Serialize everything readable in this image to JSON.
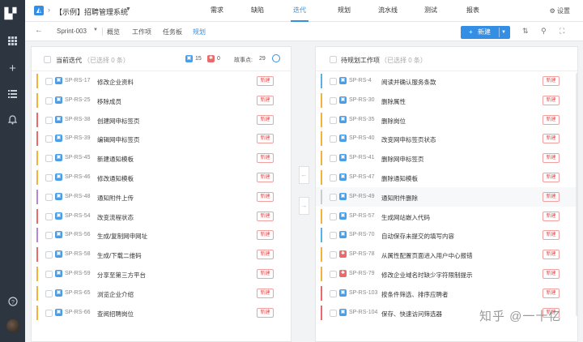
{
  "rail": {
    "logo": "▙▘",
    "icons": [
      "grid-icon",
      "plus-icon",
      "list-icon",
      "bell-icon",
      "help-icon",
      "avatar"
    ]
  },
  "topbar": {
    "project_name": "【示例】招聘管理系统",
    "tabs": [
      {
        "label": "需求",
        "active": false
      },
      {
        "label": "缺陷",
        "active": false
      },
      {
        "label": "迭代",
        "active": true
      },
      {
        "label": "规划",
        "active": false
      },
      {
        "label": "流水线",
        "active": false
      },
      {
        "label": "测试",
        "active": false
      },
      {
        "label": "报表",
        "active": false
      }
    ],
    "settings_label": "设置"
  },
  "subbar": {
    "sprint": "Sprint-003",
    "tabs": [
      {
        "label": "概览",
        "active": false
      },
      {
        "label": "工作项",
        "active": false
      },
      {
        "label": "任务板",
        "active": false
      },
      {
        "label": "规划",
        "active": true
      }
    ],
    "new_label": "新建"
  },
  "left_panel": {
    "title": "当前迭代",
    "selected": "（已选择 0 条）",
    "story_count": "15",
    "bug_count": "0",
    "points_label": "故事点:",
    "points": "29",
    "items": [
      {
        "code": "SP-RS-17",
        "title": "修改企业资料",
        "status": "新建",
        "type": "story",
        "stripe": "#f2b33d"
      },
      {
        "code": "SP-RS-25",
        "title": "移除成员",
        "status": "新建",
        "type": "story",
        "stripe": "#f2b33d"
      },
      {
        "code": "SP-RS-38",
        "title": "创建网申标签页",
        "status": "新建",
        "type": "story",
        "stripe": "#e86a6a"
      },
      {
        "code": "SP-RS-39",
        "title": "编辑网申标签页",
        "status": "新建",
        "type": "story",
        "stripe": "#e86a6a"
      },
      {
        "code": "SP-RS-45",
        "title": "新建通知模板",
        "status": "新建",
        "type": "story",
        "stripe": "#f2b33d"
      },
      {
        "code": "SP-RS-46",
        "title": "修改通知模板",
        "status": "新建",
        "type": "story",
        "stripe": "#f2b33d"
      },
      {
        "code": "SP-RS-48",
        "title": "通知附件上传",
        "status": "新建",
        "type": "story",
        "stripe": "#b488d4"
      },
      {
        "code": "SP-RS-54",
        "title": "改变流程状态",
        "status": "新建",
        "type": "story",
        "stripe": "#e86a6a"
      },
      {
        "code": "SP-RS-56",
        "title": "生成/复制网申网址",
        "status": "新建",
        "type": "story",
        "stripe": "#b488d4"
      },
      {
        "code": "SP-RS-58",
        "title": "生成/下载二维码",
        "status": "新建",
        "type": "story",
        "stripe": "#e86a6a"
      },
      {
        "code": "SP-RS-59",
        "title": "分享至第三方平台",
        "status": "新建",
        "type": "story",
        "stripe": "#f2b33d"
      },
      {
        "code": "SP-RS-65",
        "title": "浏览企业介绍",
        "status": "新建",
        "type": "story",
        "stripe": "#f2b33d"
      },
      {
        "code": "SP-RS-66",
        "title": "查阅招聘岗位",
        "status": "新建",
        "type": "story",
        "stripe": "#f2b33d"
      }
    ]
  },
  "right_panel": {
    "title": "待规划工作项",
    "selected": "（已选择 0 条）",
    "items": [
      {
        "code": "SP-RS-4",
        "title": "阅读并确认服务条款",
        "status": "新建",
        "type": "story",
        "stripe": "#5ab0e8"
      },
      {
        "code": "SP-RS-30",
        "title": "删除属性",
        "status": "新建",
        "type": "story",
        "stripe": "#f2b33d"
      },
      {
        "code": "SP-RS-35",
        "title": "删除岗位",
        "status": "新建",
        "type": "story",
        "stripe": "#f2b33d"
      },
      {
        "code": "SP-RS-40",
        "title": "改变网申标签页状态",
        "status": "新建",
        "type": "story",
        "stripe": "#f2b33d"
      },
      {
        "code": "SP-RS-41",
        "title": "删除网申标签页",
        "status": "新建",
        "type": "story",
        "stripe": "#f2b33d"
      },
      {
        "code": "SP-RS-47",
        "title": "删除通知模板",
        "status": "新建",
        "type": "story",
        "stripe": "#f2b33d"
      },
      {
        "code": "SP-RS-49",
        "title": "通知附件删除",
        "status": "新建",
        "type": "story",
        "stripe": "#cccccc"
      },
      {
        "code": "SP-RS-57",
        "title": "生成网站嵌入代码",
        "status": "新建",
        "type": "story",
        "stripe": "#f2b33d"
      },
      {
        "code": "SP-RS-70",
        "title": "自动保存未提交的填写内容",
        "status": "新建",
        "type": "story",
        "stripe": "#5ab0e8"
      },
      {
        "code": "SP-RS-78",
        "title": "从属性配置页面进入用户中心报错",
        "status": "新建",
        "type": "bug",
        "stripe": "#f2b33d"
      },
      {
        "code": "SP-RS-79",
        "title": "修改企业域名时缺少字符限制提示",
        "status": "新建",
        "type": "bug",
        "stripe": "#f2b33d"
      },
      {
        "code": "SP-RS-103",
        "title": "按条件筛选、排序应聘者",
        "status": "新建",
        "type": "story",
        "stripe": "#e86a6a"
      },
      {
        "code": "SP-RS-104",
        "title": "保存、快速访问筛选器",
        "status": "新建",
        "type": "story",
        "stripe": "#e86a6a"
      }
    ]
  },
  "colors": {
    "accent": "#348fe4",
    "story": "#4a9ee8",
    "bug": "#e86a6a"
  },
  "watermark": "知乎 @一十亿"
}
